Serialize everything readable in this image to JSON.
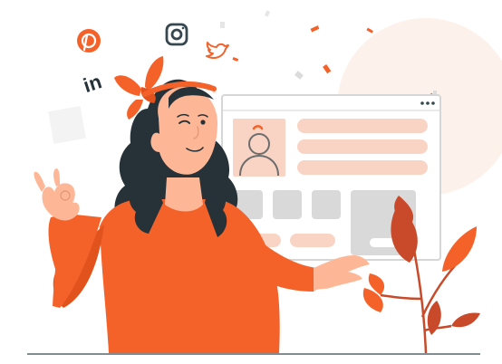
{
  "illustration": {
    "social_icons": [
      "pinterest-icon",
      "instagram-icon",
      "twitter-icon",
      "linkedin-icon"
    ],
    "linkedin_text": "in"
  },
  "colors": {
    "accent": "#f4622a",
    "accent_dark": "#e2521d",
    "peach": "#f9d4c4",
    "peach_light": "#fdf1eb",
    "skin": "#fdb796",
    "hair": "#263238",
    "grey_block": "#d9d9d9",
    "window_border": "#d6d6d6",
    "leaf_red": "#c84a2a"
  }
}
